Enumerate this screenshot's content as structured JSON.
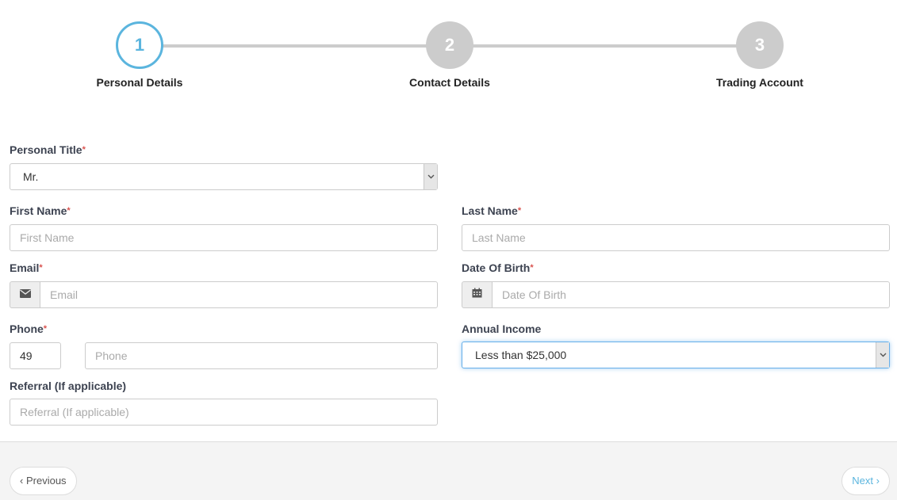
{
  "wizard": {
    "steps": [
      {
        "number": "1",
        "label": "Personal Details",
        "state": "active"
      },
      {
        "number": "2",
        "label": "Contact Details",
        "state": "inactive"
      },
      {
        "number": "3",
        "label": "Trading Account",
        "state": "inactive"
      }
    ]
  },
  "form": {
    "required_marker": "*",
    "personal_title": {
      "label": "Personal Title",
      "value": "Mr."
    },
    "first_name": {
      "label": "First Name",
      "placeholder": "First Name"
    },
    "last_name": {
      "label": "Last Name",
      "placeholder": "Last Name"
    },
    "email": {
      "label": "Email",
      "placeholder": "Email",
      "icon": "envelope-icon"
    },
    "date_of_birth": {
      "label": "Date Of Birth",
      "placeholder": "Date Of Birth",
      "icon": "calendar-icon"
    },
    "phone": {
      "label": "Phone",
      "country_code": "49",
      "placeholder": "Phone"
    },
    "annual_income": {
      "label": "Annual Income",
      "value": "Less than $25,000"
    },
    "referral": {
      "label": "Referral (If applicable)",
      "placeholder": "Referral (If applicable)"
    }
  },
  "footer": {
    "previous_label": "Previous",
    "next_label": "Next",
    "previous_icon": "‹",
    "next_icon": "›"
  },
  "colors": {
    "accent": "#5bb5de",
    "inactive_step": "#cccccc",
    "required": "#d9534f"
  }
}
